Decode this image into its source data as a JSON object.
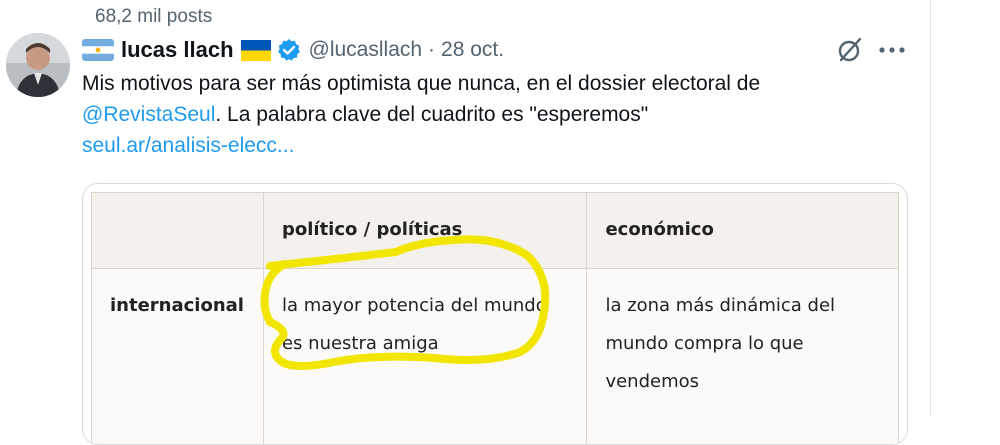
{
  "header": {
    "post_count": "68,2 mil posts"
  },
  "tweet": {
    "display_name": "lucas llach",
    "handle": "@lucasllach",
    "separator": "·",
    "date": "28 oct.",
    "text_line1": "Mis motivos para ser más optimista que nunca, en el dossier electoral de",
    "mention": "@RevistaSeul",
    "text_line2": ". La palabra clave del cuadrito es \"esperemos\"",
    "link": "seul.ar/analisis-elecc..."
  },
  "table": {
    "headers": [
      "",
      "político / políticas",
      "económico"
    ],
    "rows": [
      {
        "label": "internacional",
        "cells": [
          "la mayor potencia del mundo es nuestra amiga",
          "la zona más dinámica del mundo compra lo que vendemos"
        ]
      }
    ]
  },
  "icons": {
    "verified": "verified-badge-icon",
    "grok": "grok-icon",
    "more": "more-options-icon",
    "flag_left": "argentina-flag-icon",
    "flag_right": "ukraine-flag-icon"
  },
  "colors": {
    "link": "#1d9bf0",
    "secondary_text": "#536471",
    "highlight": "#f2e600",
    "verified": "#1d9bf0"
  }
}
